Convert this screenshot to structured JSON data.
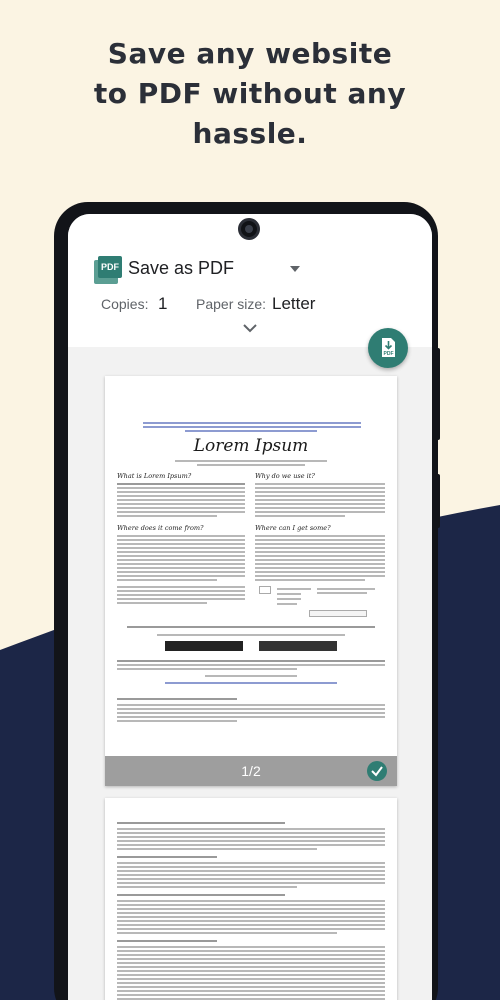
{
  "headline": {
    "line1": "Save any website",
    "line2": "to PDF without any",
    "line3": "hassle."
  },
  "print_dialog": {
    "destination": "Save as PDF",
    "destination_icon": "pdf-icon",
    "copies_label": "Copies:",
    "copies_value": "1",
    "paper_size_label": "Paper size:",
    "paper_size_value": "Letter",
    "fab_icon": "download-pdf-icon"
  },
  "preview": {
    "page1": {
      "doc_title": "Lorem Ipsum",
      "page_indicator": "1/2",
      "selected": true
    }
  },
  "colors": {
    "accent": "#2f7d73",
    "background": "#fbf4e3",
    "wave": "#1c2647"
  }
}
